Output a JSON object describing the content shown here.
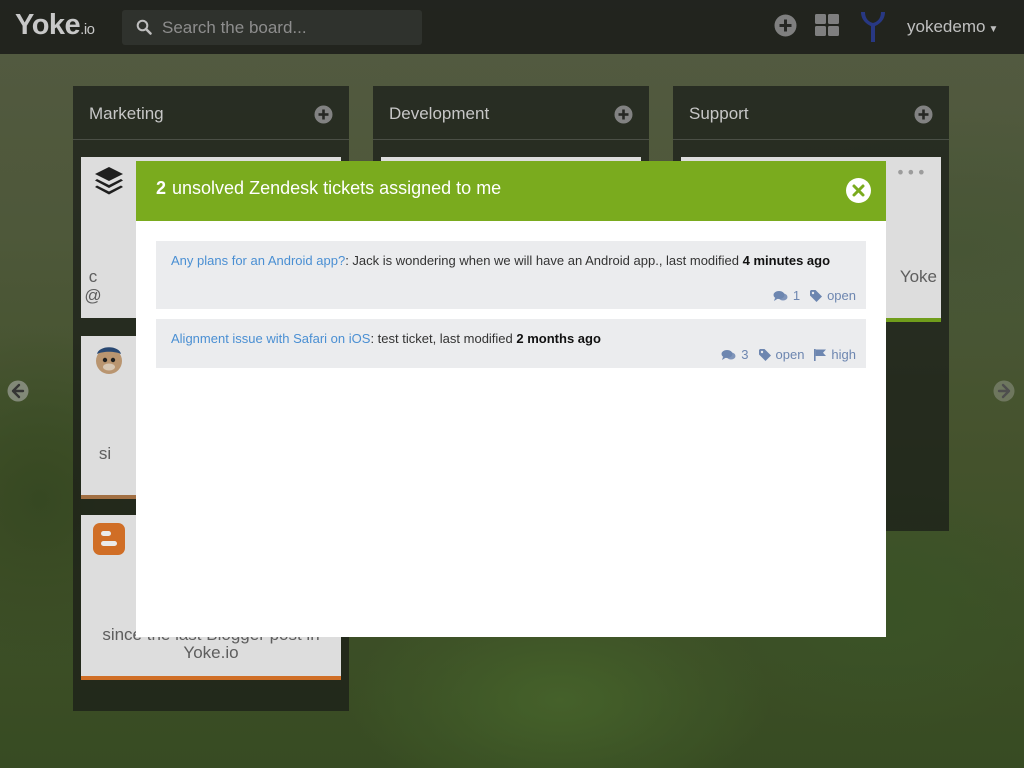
{
  "topbar": {
    "logo_main": "Yoke",
    "logo_suffix": ".io",
    "search_placeholder": "Search the board...",
    "username": "yokedemo"
  },
  "columns": [
    {
      "title": "Marketing"
    },
    {
      "title": "Development"
    },
    {
      "title": "Support"
    }
  ],
  "background_cards": {
    "marketing_1_partial": "c",
    "marketing_1_partial_2": "@",
    "marketing_2_partial": "si",
    "marketing_3_line1": "since the last Blogger post in",
    "marketing_3_line2": "Yoke.io",
    "support_1_partial": "Yoke"
  },
  "modal": {
    "count": "2",
    "title": "unsolved Zendesk tickets assigned to me",
    "tickets": [
      {
        "title": "Any plans for an Android app?",
        "description": ": Jack is wondering when we will have an Android app., last modified ",
        "modified": "4 minutes ago",
        "comments": "1",
        "status": "open"
      },
      {
        "title": "Alignment issue with Safari on iOS",
        "description": ": test ticket, last modified ",
        "modified": "2 months ago",
        "comments": "3",
        "status": "open",
        "priority": "high"
      }
    ]
  },
  "colors": {
    "modal_header": "#7aab1e",
    "ticket_link": "#4a8fd3",
    "meta": "#6d86b0",
    "orange_accent": "#e2782a",
    "green_accent": "#7aab1e"
  }
}
